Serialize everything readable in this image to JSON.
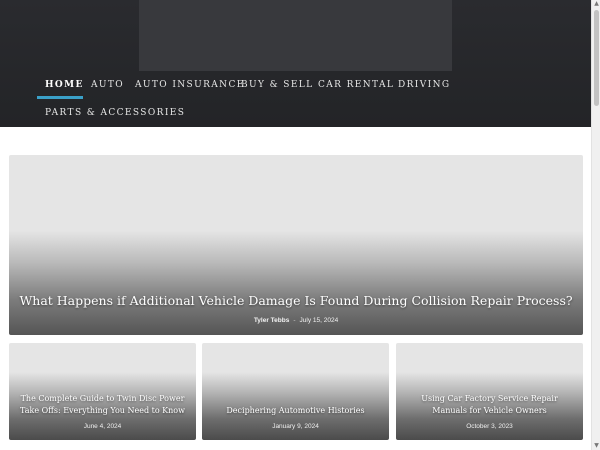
{
  "nav": {
    "items": [
      {
        "label": "HOME",
        "active": true
      },
      {
        "label": "AUTO"
      },
      {
        "label": "AUTO INSURANCE"
      },
      {
        "label": "BUY & SELL"
      },
      {
        "label": "CAR RENTAL"
      },
      {
        "label": "DRIVING"
      },
      {
        "label": "PARTS & ACCESSORIES"
      }
    ],
    "accent_color": "#3aa0c8"
  },
  "featured": {
    "title": "What Happens if Additional Vehicle Damage Is Found During Collision Repair Process?",
    "author": "Tyler Tebbs",
    "separator": "-",
    "date": "July 15, 2024"
  },
  "cards": [
    {
      "title": "The Complete Guide to Twin Disc Power Take Offs: Everything You Need to Know",
      "date": "June 4, 2024"
    },
    {
      "title": "Deciphering Automotive Histories",
      "date": "January 9, 2024"
    },
    {
      "title": "Using Car Factory Service Repair Manuals for Vehicle Owners",
      "date": "October 3, 2023"
    }
  ]
}
